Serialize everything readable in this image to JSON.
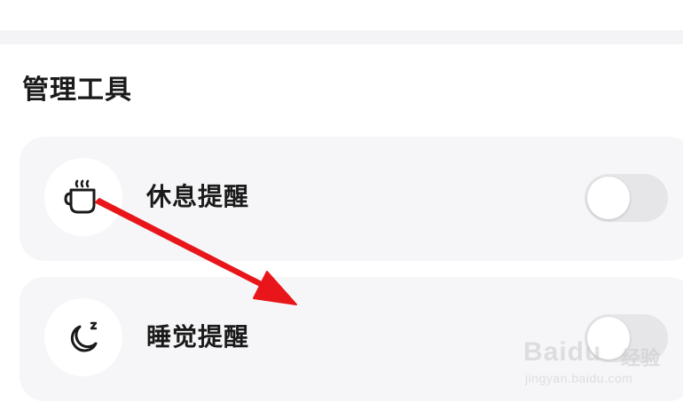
{
  "section": {
    "title": "管理工具"
  },
  "items": [
    {
      "label": "休息提醒",
      "icon": "coffee-cup-icon",
      "toggle_on": false
    },
    {
      "label": "睡觉提醒",
      "icon": "moon-sleep-icon",
      "toggle_on": false
    }
  ],
  "annotation": {
    "color": "#e8161b"
  },
  "watermark": {
    "brand": "Baidu",
    "cn": "经验",
    "url": "jingyan.baidu.com"
  },
  "colors": {
    "card_bg": "#f6f6f8",
    "toggle_off_bg": "#e6e6e8",
    "divider": "#f4f4f6"
  }
}
